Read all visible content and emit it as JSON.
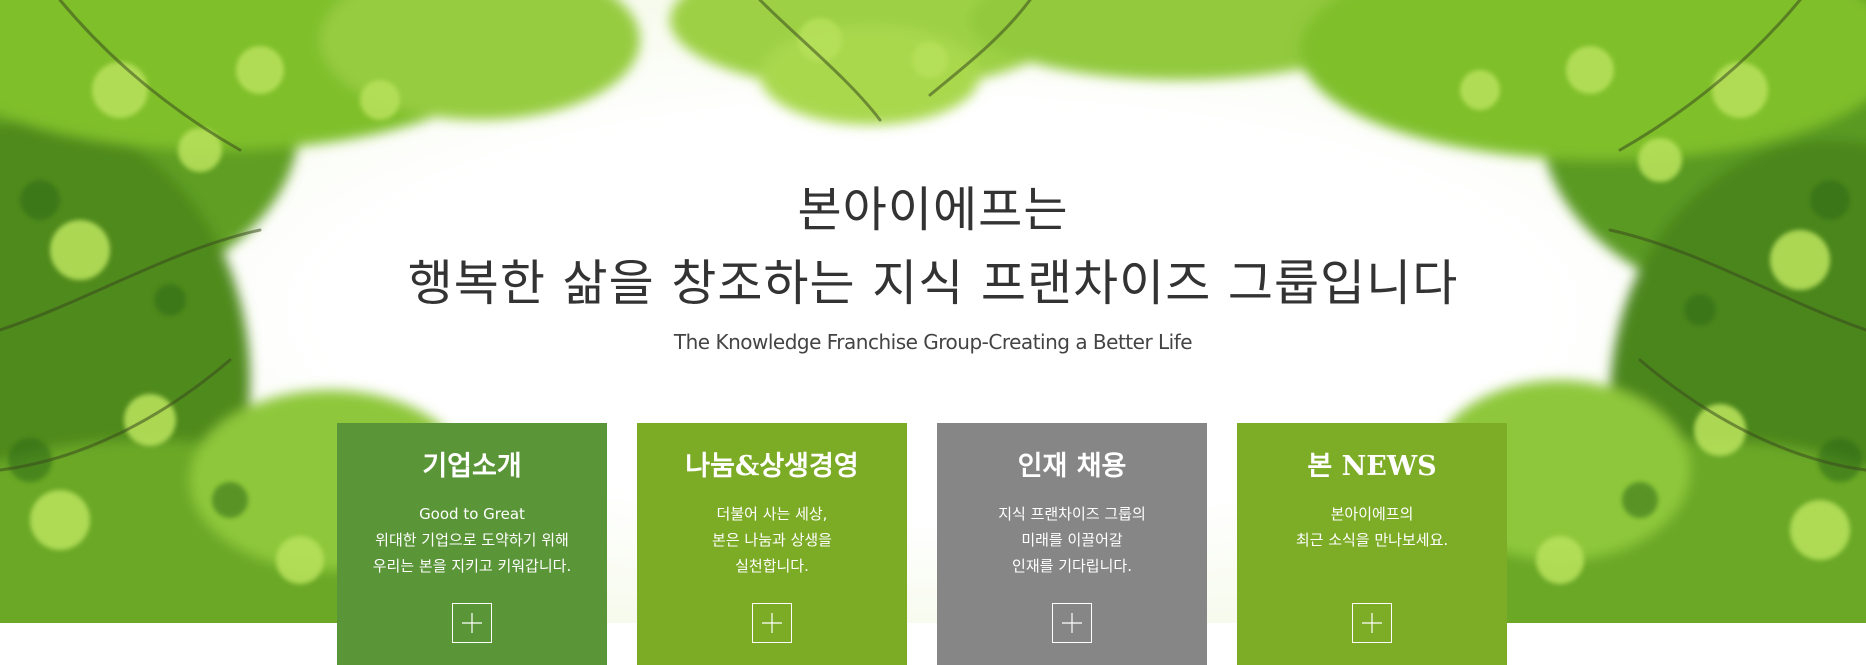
{
  "hero": {
    "headline_line1": "본아이에프는",
    "headline_line2": "행복한 삶을 창조하는 지식 프랜차이즈 그룹입니다",
    "subline": "The Knowledge Franchise Group-Creating a Better Life"
  },
  "cards": [
    {
      "title": "기업소개",
      "lines": [
        "Good to Great",
        "위대한 기업으로 도약하기 위해",
        "우리는 본을 지키고 키워갑니다."
      ],
      "color": "#5a9638",
      "icon": "plus-icon"
    },
    {
      "title": "나눔&상생경영",
      "lines": [
        "더불어 사는 세상,",
        "본은 나눔과 상생을",
        "실천합니다."
      ],
      "color": "#7cab25",
      "icon": "plus-icon"
    },
    {
      "title": "인재 채용",
      "lines": [
        "지식 프랜차이즈 그룹의",
        "미래를 이끌어갈",
        "인재를 기다립니다."
      ],
      "color": "#868686",
      "icon": "plus-icon"
    },
    {
      "title": "본 NEWS",
      "lines": [
        "본아이에프의",
        "최근 소식을 만나보세요."
      ],
      "color": "#7dac27",
      "icon": "plus-icon"
    }
  ],
  "colors": {
    "leaf_light": "#a6d93c",
    "leaf_mid": "#78b52a",
    "leaf_dark": "#3f7a1d",
    "headline_text": "#333333"
  }
}
